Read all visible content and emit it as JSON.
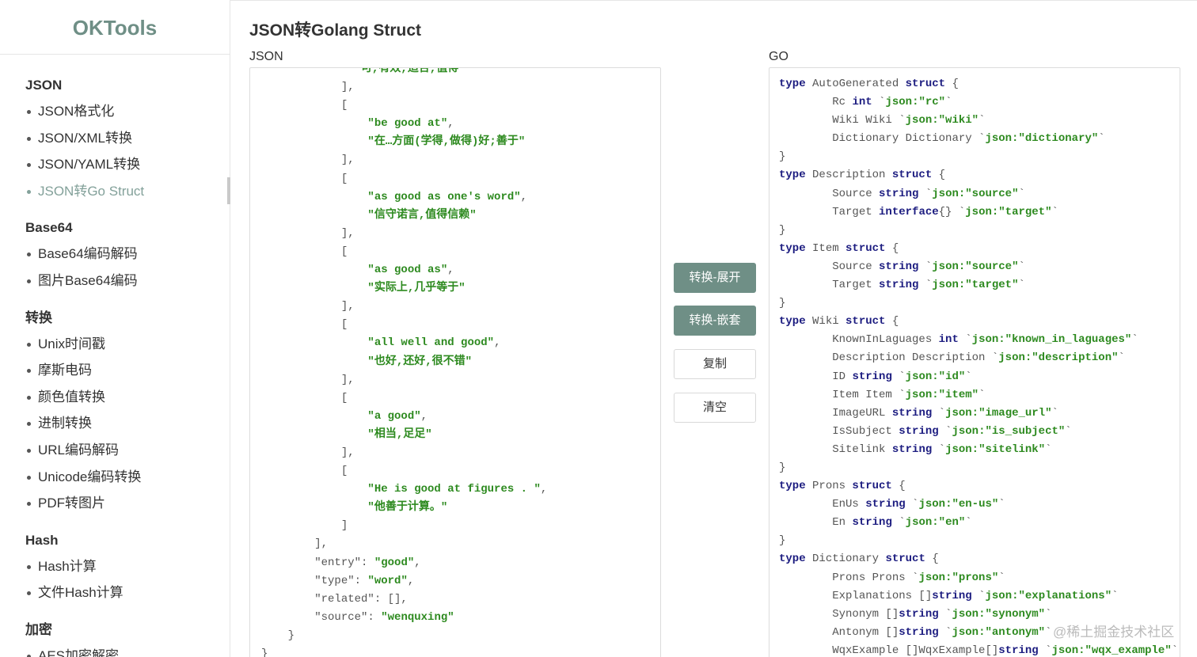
{
  "app": {
    "logo": "OKTools",
    "title": "JSON转Golang Struct"
  },
  "sidebar": {
    "groups": [
      {
        "title": "JSON",
        "items": [
          "JSON格式化",
          "JSON/XML转换",
          "JSON/YAML转换",
          "JSON转Go Struct"
        ]
      },
      {
        "title": "Base64",
        "items": [
          "Base64编码解码",
          "图片Base64编码"
        ]
      },
      {
        "title": "转换",
        "items": [
          "Unix时间戳",
          "摩斯电码",
          "颜色值转换",
          "进制转换",
          "URL编码解码",
          "Unicode编码转换",
          "PDF转图片"
        ]
      },
      {
        "title": "Hash",
        "items": [
          "Hash计算",
          "文件Hash计算"
        ]
      },
      {
        "title": "加密",
        "items": [
          "AES加密解密"
        ]
      }
    ],
    "active_item": "JSON转Go Struct"
  },
  "json_panel": {
    "label": "JSON",
    "lines": [
      {
        "indent": 14,
        "tokens": [
          {
            "t": "\"可,有效,适合,值得\"",
            "c": "str"
          }
        ]
      },
      {
        "indent": 12,
        "tokens": [
          {
            "t": "],",
            "c": "p"
          }
        ]
      },
      {
        "indent": 12,
        "tokens": [
          {
            "t": "[",
            "c": "p"
          }
        ]
      },
      {
        "indent": 16,
        "tokens": [
          {
            "t": "\"be good at\"",
            "c": "str"
          },
          {
            "t": ",",
            "c": "p"
          }
        ]
      },
      {
        "indent": 16,
        "tokens": [
          {
            "t": "\"在…方面(学得,做得)好;善于\"",
            "c": "str"
          }
        ]
      },
      {
        "indent": 12,
        "tokens": [
          {
            "t": "],",
            "c": "p"
          }
        ]
      },
      {
        "indent": 12,
        "tokens": [
          {
            "t": "[",
            "c": "p"
          }
        ]
      },
      {
        "indent": 16,
        "tokens": [
          {
            "t": "\"as good as one's word\"",
            "c": "str"
          },
          {
            "t": ",",
            "c": "p"
          }
        ]
      },
      {
        "indent": 16,
        "tokens": [
          {
            "t": "\"信守诺言,值得信赖\"",
            "c": "str"
          }
        ]
      },
      {
        "indent": 12,
        "tokens": [
          {
            "t": "],",
            "c": "p"
          }
        ]
      },
      {
        "indent": 12,
        "tokens": [
          {
            "t": "[",
            "c": "p"
          }
        ]
      },
      {
        "indent": 16,
        "tokens": [
          {
            "t": "\"as good as\"",
            "c": "str"
          },
          {
            "t": ",",
            "c": "p"
          }
        ]
      },
      {
        "indent": 16,
        "tokens": [
          {
            "t": "\"实际上,几乎等于\"",
            "c": "str"
          }
        ]
      },
      {
        "indent": 12,
        "tokens": [
          {
            "t": "],",
            "c": "p"
          }
        ]
      },
      {
        "indent": 12,
        "tokens": [
          {
            "t": "[",
            "c": "p"
          }
        ]
      },
      {
        "indent": 16,
        "tokens": [
          {
            "t": "\"all well and good\"",
            "c": "str"
          },
          {
            "t": ",",
            "c": "p"
          }
        ]
      },
      {
        "indent": 16,
        "tokens": [
          {
            "t": "\"也好,还好,很不错\"",
            "c": "str"
          }
        ]
      },
      {
        "indent": 12,
        "tokens": [
          {
            "t": "],",
            "c": "p"
          }
        ]
      },
      {
        "indent": 12,
        "tokens": [
          {
            "t": "[",
            "c": "p"
          }
        ]
      },
      {
        "indent": 16,
        "tokens": [
          {
            "t": "\"a good\"",
            "c": "str"
          },
          {
            "t": ",",
            "c": "p"
          }
        ]
      },
      {
        "indent": 16,
        "tokens": [
          {
            "t": "\"相当,足足\"",
            "c": "str"
          }
        ]
      },
      {
        "indent": 12,
        "tokens": [
          {
            "t": "],",
            "c": "p"
          }
        ]
      },
      {
        "indent": 12,
        "tokens": [
          {
            "t": "[",
            "c": "p"
          }
        ]
      },
      {
        "indent": 16,
        "tokens": [
          {
            "t": "\"He is good at figures . \"",
            "c": "str"
          },
          {
            "t": ",",
            "c": "p"
          }
        ]
      },
      {
        "indent": 16,
        "tokens": [
          {
            "t": "\"他善于计算。\"",
            "c": "str"
          }
        ]
      },
      {
        "indent": 12,
        "tokens": [
          {
            "t": "]",
            "c": "p"
          }
        ]
      },
      {
        "indent": 8,
        "tokens": [
          {
            "t": "],",
            "c": "p"
          }
        ]
      },
      {
        "indent": 8,
        "tokens": [
          {
            "t": "\"entry\": ",
            "c": "p"
          },
          {
            "t": "\"good\"",
            "c": "str"
          },
          {
            "t": ",",
            "c": "p"
          }
        ]
      },
      {
        "indent": 8,
        "tokens": [
          {
            "t": "\"type\": ",
            "c": "p"
          },
          {
            "t": "\"word\"",
            "c": "str"
          },
          {
            "t": ",",
            "c": "p"
          }
        ]
      },
      {
        "indent": 8,
        "tokens": [
          {
            "t": "\"related\": [],",
            "c": "p"
          }
        ]
      },
      {
        "indent": 8,
        "tokens": [
          {
            "t": "\"source\": ",
            "c": "p"
          },
          {
            "t": "\"wenquxing\"",
            "c": "str"
          }
        ]
      },
      {
        "indent": 4,
        "tokens": [
          {
            "t": "}",
            "c": "p"
          }
        ]
      },
      {
        "indent": 0,
        "tokens": [
          {
            "t": "}",
            "c": "p"
          }
        ]
      }
    ]
  },
  "go_panel": {
    "label": "GO",
    "lines": [
      {
        "indent": 0,
        "tokens": [
          {
            "t": "type",
            "c": "kw"
          },
          {
            "t": " AutoGenerated ",
            "c": "p"
          },
          {
            "t": "struct",
            "c": "kw"
          },
          {
            "t": " {",
            "c": "p"
          }
        ]
      },
      {
        "indent": 8,
        "tokens": [
          {
            "t": "Rc ",
            "c": "p"
          },
          {
            "t": "int",
            "c": "kw"
          },
          {
            "t": " `",
            "c": "p"
          },
          {
            "t": "json:\"rc\"",
            "c": "str"
          },
          {
            "t": "`",
            "c": "p"
          }
        ]
      },
      {
        "indent": 8,
        "tokens": [
          {
            "t": "Wiki Wiki `",
            "c": "p"
          },
          {
            "t": "json:\"wiki\"",
            "c": "str"
          },
          {
            "t": "`",
            "c": "p"
          }
        ]
      },
      {
        "indent": 8,
        "tokens": [
          {
            "t": "Dictionary Dictionary `",
            "c": "p"
          },
          {
            "t": "json:\"dictionary\"",
            "c": "str"
          },
          {
            "t": "`",
            "c": "p"
          }
        ]
      },
      {
        "indent": 0,
        "tokens": [
          {
            "t": "}",
            "c": "p"
          }
        ]
      },
      {
        "indent": 0,
        "tokens": [
          {
            "t": "type",
            "c": "kw"
          },
          {
            "t": " Description ",
            "c": "p"
          },
          {
            "t": "struct",
            "c": "kw"
          },
          {
            "t": " {",
            "c": "p"
          }
        ]
      },
      {
        "indent": 8,
        "tokens": [
          {
            "t": "Source ",
            "c": "p"
          },
          {
            "t": "string",
            "c": "kw"
          },
          {
            "t": " `",
            "c": "p"
          },
          {
            "t": "json:\"source\"",
            "c": "str"
          },
          {
            "t": "`",
            "c": "p"
          }
        ]
      },
      {
        "indent": 8,
        "tokens": [
          {
            "t": "Target ",
            "c": "p"
          },
          {
            "t": "interface",
            "c": "kw"
          },
          {
            "t": "{} `",
            "c": "p"
          },
          {
            "t": "json:\"target\"",
            "c": "str"
          },
          {
            "t": "`",
            "c": "p"
          }
        ]
      },
      {
        "indent": 0,
        "tokens": [
          {
            "t": "}",
            "c": "p"
          }
        ]
      },
      {
        "indent": 0,
        "tokens": [
          {
            "t": "type",
            "c": "kw"
          },
          {
            "t": " Item ",
            "c": "p"
          },
          {
            "t": "struct",
            "c": "kw"
          },
          {
            "t": " {",
            "c": "p"
          }
        ]
      },
      {
        "indent": 8,
        "tokens": [
          {
            "t": "Source ",
            "c": "p"
          },
          {
            "t": "string",
            "c": "kw"
          },
          {
            "t": " `",
            "c": "p"
          },
          {
            "t": "json:\"source\"",
            "c": "str"
          },
          {
            "t": "`",
            "c": "p"
          }
        ]
      },
      {
        "indent": 8,
        "tokens": [
          {
            "t": "Target ",
            "c": "p"
          },
          {
            "t": "string",
            "c": "kw"
          },
          {
            "t": " `",
            "c": "p"
          },
          {
            "t": "json:\"target\"",
            "c": "str"
          },
          {
            "t": "`",
            "c": "p"
          }
        ]
      },
      {
        "indent": 0,
        "tokens": [
          {
            "t": "}",
            "c": "p"
          }
        ]
      },
      {
        "indent": 0,
        "tokens": [
          {
            "t": "type",
            "c": "kw"
          },
          {
            "t": " Wiki ",
            "c": "p"
          },
          {
            "t": "struct",
            "c": "kw"
          },
          {
            "t": " {",
            "c": "p"
          }
        ]
      },
      {
        "indent": 8,
        "tokens": [
          {
            "t": "KnownInLaguages ",
            "c": "p"
          },
          {
            "t": "int",
            "c": "kw"
          },
          {
            "t": " `",
            "c": "p"
          },
          {
            "t": "json:\"known_in_laguages\"",
            "c": "str"
          },
          {
            "t": "`",
            "c": "p"
          }
        ]
      },
      {
        "indent": 8,
        "tokens": [
          {
            "t": "Description Description `",
            "c": "p"
          },
          {
            "t": "json:\"description\"",
            "c": "str"
          },
          {
            "t": "`",
            "c": "p"
          }
        ]
      },
      {
        "indent": 8,
        "tokens": [
          {
            "t": "ID ",
            "c": "p"
          },
          {
            "t": "string",
            "c": "kw"
          },
          {
            "t": " `",
            "c": "p"
          },
          {
            "t": "json:\"id\"",
            "c": "str"
          },
          {
            "t": "`",
            "c": "p"
          }
        ]
      },
      {
        "indent": 8,
        "tokens": [
          {
            "t": "Item Item `",
            "c": "p"
          },
          {
            "t": "json:\"item\"",
            "c": "str"
          },
          {
            "t": "`",
            "c": "p"
          }
        ]
      },
      {
        "indent": 8,
        "tokens": [
          {
            "t": "ImageURL ",
            "c": "p"
          },
          {
            "t": "string",
            "c": "kw"
          },
          {
            "t": " `",
            "c": "p"
          },
          {
            "t": "json:\"image_url\"",
            "c": "str"
          },
          {
            "t": "`",
            "c": "p"
          }
        ]
      },
      {
        "indent": 8,
        "tokens": [
          {
            "t": "IsSubject ",
            "c": "p"
          },
          {
            "t": "string",
            "c": "kw"
          },
          {
            "t": " `",
            "c": "p"
          },
          {
            "t": "json:\"is_subject\"",
            "c": "str"
          },
          {
            "t": "`",
            "c": "p"
          }
        ]
      },
      {
        "indent": 8,
        "tokens": [
          {
            "t": "Sitelink ",
            "c": "p"
          },
          {
            "t": "string",
            "c": "kw"
          },
          {
            "t": " `",
            "c": "p"
          },
          {
            "t": "json:\"sitelink\"",
            "c": "str"
          },
          {
            "t": "`",
            "c": "p"
          }
        ]
      },
      {
        "indent": 0,
        "tokens": [
          {
            "t": "}",
            "c": "p"
          }
        ]
      },
      {
        "indent": 0,
        "tokens": [
          {
            "t": "type",
            "c": "kw"
          },
          {
            "t": " Prons ",
            "c": "p"
          },
          {
            "t": "struct",
            "c": "kw"
          },
          {
            "t": " {",
            "c": "p"
          }
        ]
      },
      {
        "indent": 8,
        "tokens": [
          {
            "t": "EnUs ",
            "c": "p"
          },
          {
            "t": "string",
            "c": "kw"
          },
          {
            "t": " `",
            "c": "p"
          },
          {
            "t": "json:\"en-us\"",
            "c": "str"
          },
          {
            "t": "`",
            "c": "p"
          }
        ]
      },
      {
        "indent": 8,
        "tokens": [
          {
            "t": "En ",
            "c": "p"
          },
          {
            "t": "string",
            "c": "kw"
          },
          {
            "t": " `",
            "c": "p"
          },
          {
            "t": "json:\"en\"",
            "c": "str"
          },
          {
            "t": "`",
            "c": "p"
          }
        ]
      },
      {
        "indent": 0,
        "tokens": [
          {
            "t": "}",
            "c": "p"
          }
        ]
      },
      {
        "indent": 0,
        "tokens": [
          {
            "t": "type",
            "c": "kw"
          },
          {
            "t": " Dictionary ",
            "c": "p"
          },
          {
            "t": "struct",
            "c": "kw"
          },
          {
            "t": " {",
            "c": "p"
          }
        ]
      },
      {
        "indent": 8,
        "tokens": [
          {
            "t": "Prons Prons `",
            "c": "p"
          },
          {
            "t": "json:\"prons\"",
            "c": "str"
          },
          {
            "t": "`",
            "c": "p"
          }
        ]
      },
      {
        "indent": 8,
        "tokens": [
          {
            "t": "Explanations []",
            "c": "p"
          },
          {
            "t": "string",
            "c": "kw"
          },
          {
            "t": " `",
            "c": "p"
          },
          {
            "t": "json:\"explanations\"",
            "c": "str"
          },
          {
            "t": "`",
            "c": "p"
          }
        ]
      },
      {
        "indent": 8,
        "tokens": [
          {
            "t": "Synonym []",
            "c": "p"
          },
          {
            "t": "string",
            "c": "kw"
          },
          {
            "t": " `",
            "c": "p"
          },
          {
            "t": "json:\"synonym\"",
            "c": "str"
          },
          {
            "t": "`",
            "c": "p"
          }
        ]
      },
      {
        "indent": 8,
        "tokens": [
          {
            "t": "Antonym []",
            "c": "p"
          },
          {
            "t": "string",
            "c": "kw"
          },
          {
            "t": " `",
            "c": "p"
          },
          {
            "t": "json:\"antonym\"",
            "c": "str"
          },
          {
            "t": "`",
            "c": "p"
          }
        ]
      },
      {
        "indent": 8,
        "tokens": [
          {
            "t": "WqxExample []WqxExample[]",
            "c": "p"
          },
          {
            "t": "string",
            "c": "kw"
          },
          {
            "t": " `",
            "c": "p"
          },
          {
            "t": "json:\"wqx_example\"",
            "c": "str"
          },
          {
            "t": "`",
            "c": "p"
          }
        ]
      }
    ]
  },
  "actions": {
    "convert_expand": "转换-展开",
    "convert_nested": "转换-嵌套",
    "copy": "复制",
    "clear": "清空"
  },
  "watermark": "@稀土掘金技术社区",
  "colors": {
    "brand": "#6f8f86",
    "active_nav": "#83a19a",
    "string_token": "#2d8a1f",
    "keyword_token": "#1c1c80"
  }
}
